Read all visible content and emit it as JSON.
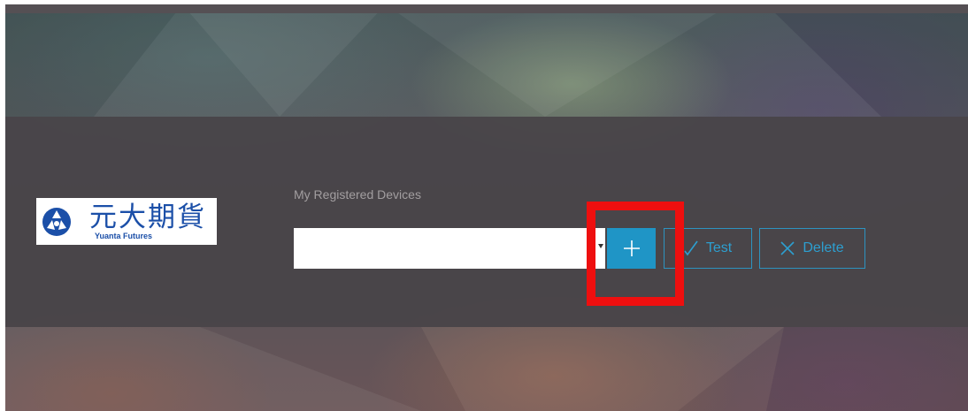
{
  "logo": {
    "chinese_name": "元大期貨",
    "english_name": "Yuanta Futures",
    "brand_color": "#1b4fa8"
  },
  "devices": {
    "section_label": "My Registered Devices",
    "selected_device": "",
    "add_icon": "plus-icon",
    "test_icon": "checkmark-icon",
    "test_label": "Test",
    "delete_icon": "x-icon",
    "delete_label": "Delete",
    "accent_color": "#1f95c6"
  },
  "annotation": {
    "highlight_color": "#ee0f0f",
    "highlight_target": "add-device-button"
  }
}
